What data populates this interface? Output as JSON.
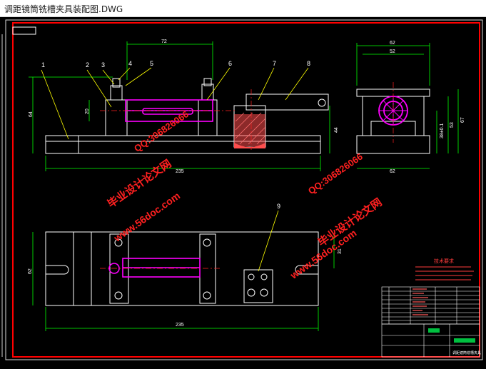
{
  "window": {
    "title": "调距镜筒铣槽夹具装配图.DWG"
  },
  "drawing": {
    "balloons": [
      "1",
      "2",
      "3",
      "4",
      "5",
      "6",
      "7",
      "8",
      "9"
    ],
    "dims": {
      "front_len_top": "72",
      "front_h_left": "64",
      "front_h_small": "20",
      "front_h_right": "44",
      "front_len_bottom": "235",
      "side_w_outer": "62",
      "side_w_inner": "52",
      "side_h_1": "38±0.1",
      "side_h_2": "53",
      "side_h_3": "67",
      "side_w_bottom": "62",
      "plan_w_left": "62",
      "plan_h_right": "31",
      "plan_len_bottom": "235"
    },
    "tech_title": "技术要求",
    "title_block_name": "调距镜筒铣槽夹具",
    "watermarks": {
      "site": "www.56doc.com",
      "brand": "毕业设计论文网",
      "qq": "QQ:306826066"
    }
  },
  "colors": {
    "background": "#000000",
    "line": "#ffffff",
    "frame": "#ff0000",
    "part": "#ff00ff",
    "section": "#ff4d4d",
    "dim": "#00ff00",
    "balloon": "#ffff00",
    "tech": "#ff3b3b",
    "watermark": "#ff0000"
  }
}
